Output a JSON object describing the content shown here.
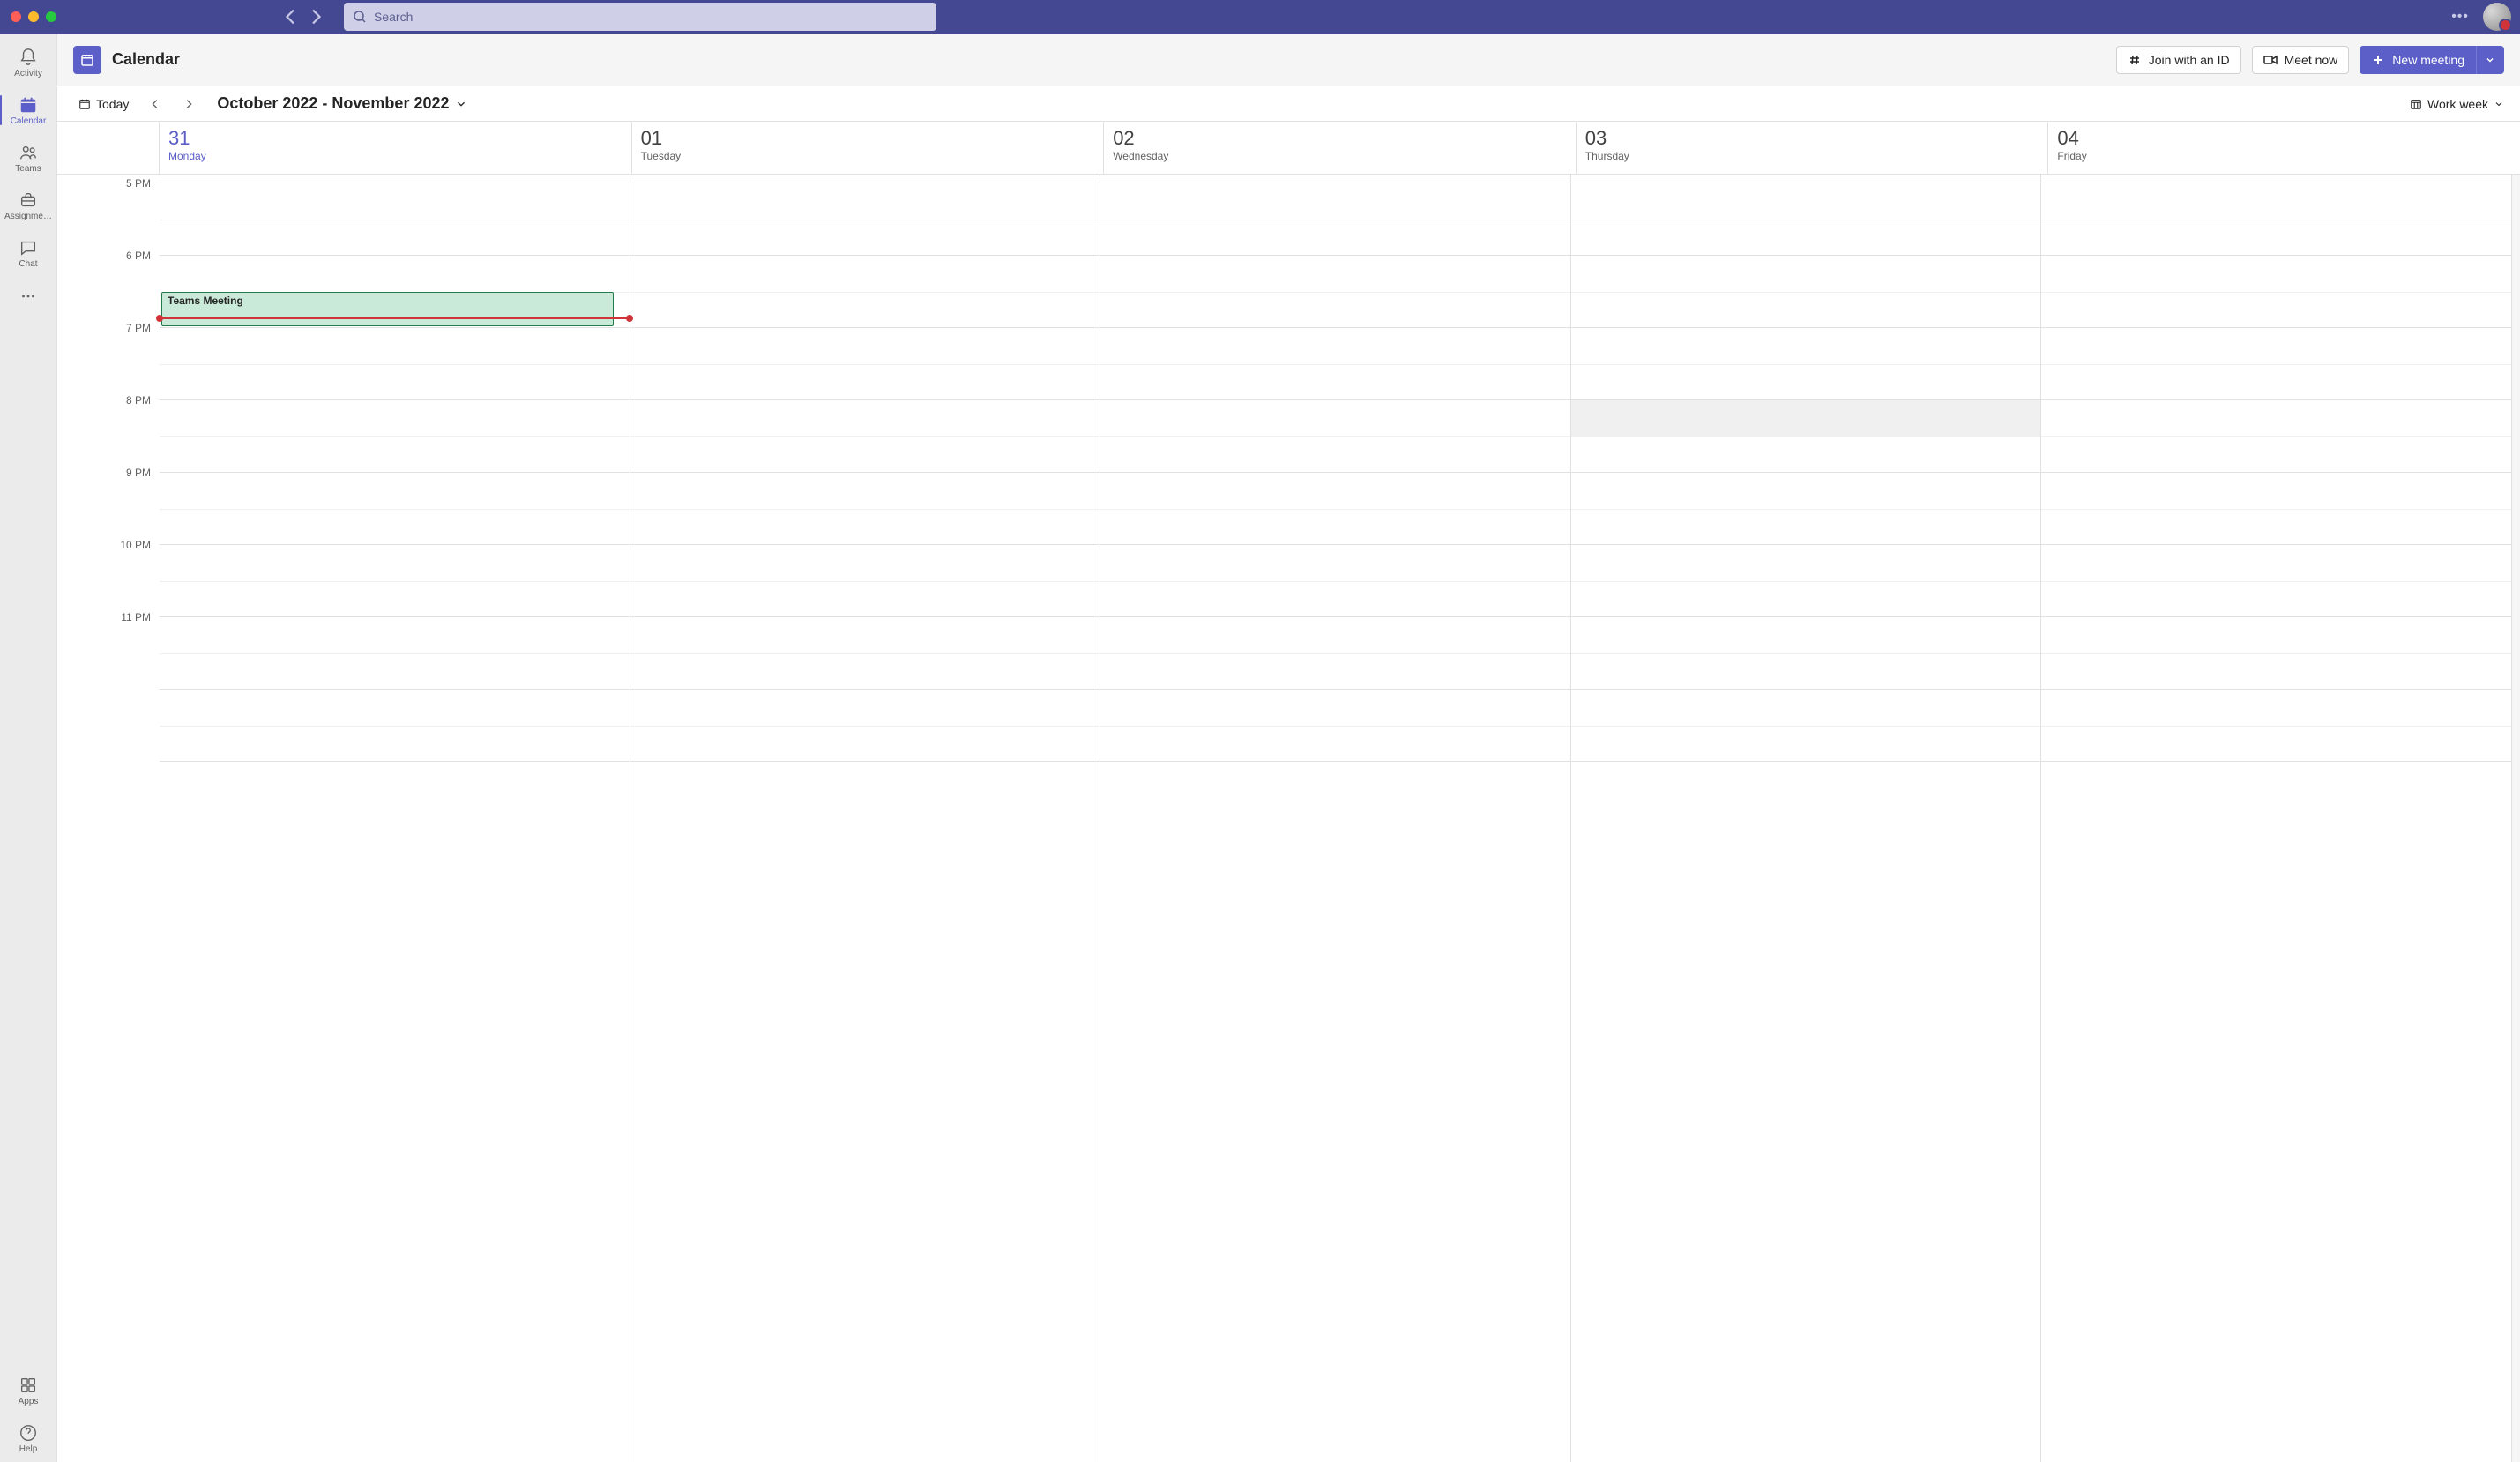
{
  "titlebar": {
    "search_placeholder": "Search"
  },
  "rail": {
    "items": [
      {
        "id": "activity",
        "label": "Activity"
      },
      {
        "id": "calendar",
        "label": "Calendar"
      },
      {
        "id": "teams",
        "label": "Teams"
      },
      {
        "id": "assignments",
        "label": "Assignme…"
      },
      {
        "id": "chat",
        "label": "Chat"
      }
    ],
    "apps_label": "Apps",
    "help_label": "Help"
  },
  "header": {
    "title": "Calendar",
    "join_label": "Join with an ID",
    "meet_label": "Meet now",
    "new_meeting_label": "New meeting"
  },
  "toolbar": {
    "today_label": "Today",
    "date_range": "October 2022 - November 2022",
    "view_label": "Work week"
  },
  "days": [
    {
      "num": "31",
      "name": "Monday",
      "today": true
    },
    {
      "num": "01",
      "name": "Tuesday",
      "today": false
    },
    {
      "num": "02",
      "name": "Wednesday",
      "today": false
    },
    {
      "num": "03",
      "name": "Thursday",
      "today": false
    },
    {
      "num": "04",
      "name": "Friday",
      "today": false
    }
  ],
  "time_labels": [
    "5 PM",
    "6 PM",
    "7 PM",
    "8 PM",
    "9 PM",
    "10 PM",
    "11 PM"
  ],
  "events": [
    {
      "title": "Teams Meeting",
      "day_index": 0,
      "start_hour_index": 1.5,
      "duration_hours": 0.5,
      "color": "#c9ead8",
      "border": "#237b4b",
      "selected": true
    }
  ],
  "now_indicator": {
    "day_index": 0,
    "hour_offset": 1.85
  },
  "busy_blocks": [
    {
      "day_index": 3,
      "start_hour_index": 3,
      "duration_hours": 0.5
    }
  ]
}
